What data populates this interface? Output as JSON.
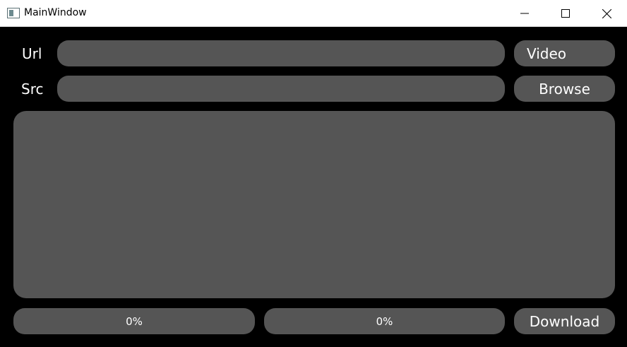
{
  "window": {
    "title": "MainWindow"
  },
  "form": {
    "url_label": "Url",
    "url_value": "",
    "src_label": "Src",
    "src_value": "",
    "video_button": "Video",
    "browse_button": "Browse"
  },
  "footer": {
    "progress_1_text": "0%",
    "progress_1_value": 0,
    "progress_2_text": "0%",
    "progress_2_value": 0,
    "download_button": "Download"
  }
}
